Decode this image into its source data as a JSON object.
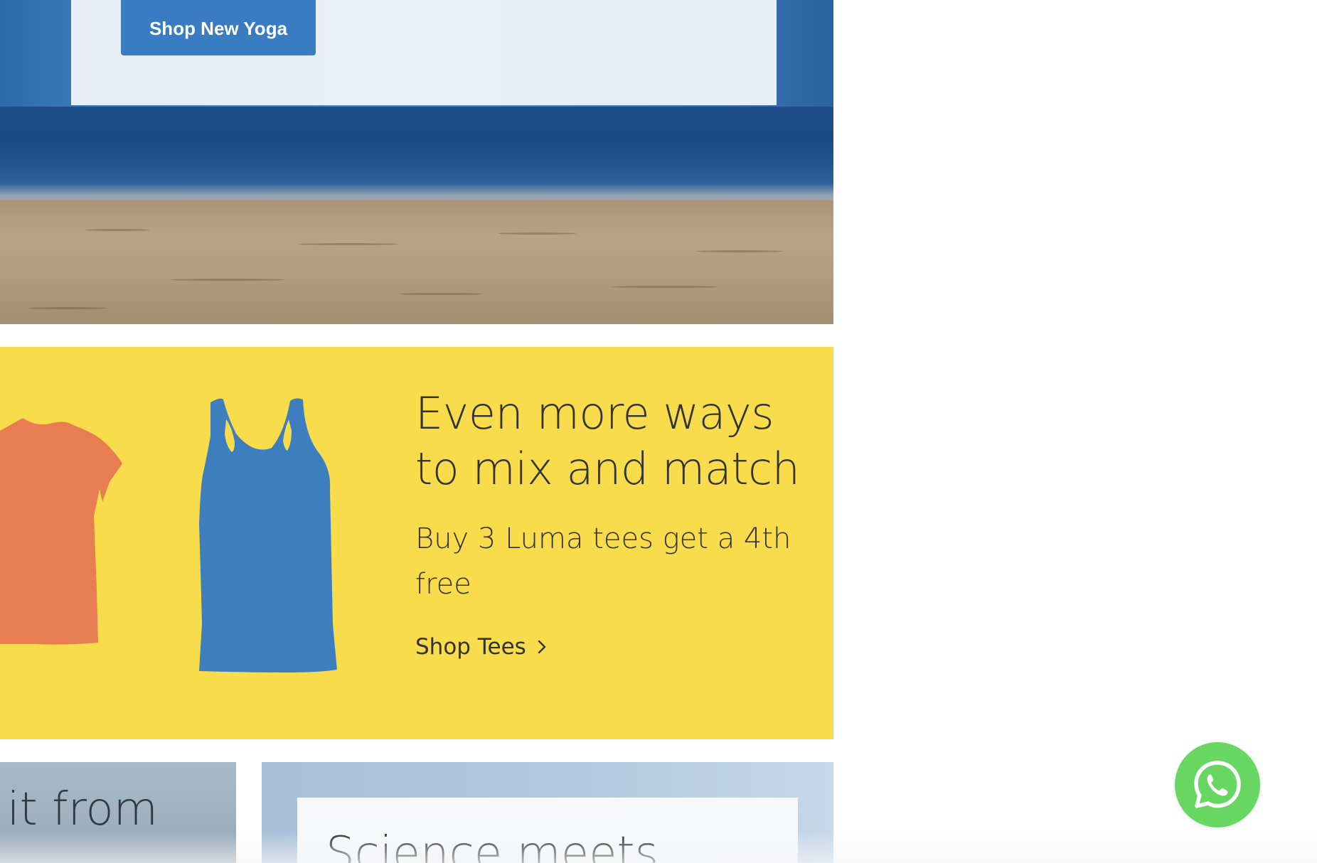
{
  "hero": {
    "button_label": "Shop New Yoga"
  },
  "promo": {
    "title_line1": "Even more ways",
    "title_line2": "to mix and match",
    "subtitle_line1": "Buy 3 Luma tees get a 4th",
    "subtitle_line2": "free",
    "link_label": "Shop Tees",
    "colors": {
      "background": "#f9dc4c",
      "orange_tee": "#e77d51",
      "blue_tank": "#3d7fbe"
    }
  },
  "tiles": {
    "left_text": "e it from",
    "right_text": "Science meets"
  },
  "whatsapp": {
    "icon": "whatsapp-icon",
    "color": "#67d762"
  }
}
